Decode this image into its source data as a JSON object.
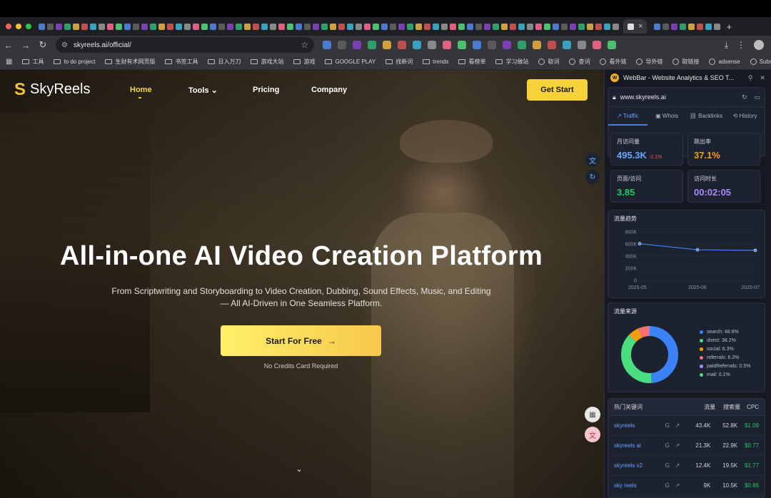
{
  "browser": {
    "tab_title": "",
    "close_tab": "×",
    "new_tab": "+",
    "url": "skyreels.ai/official/",
    "bookmarks": [
      "工具",
      "to do project",
      "生财有术网页版",
      "书签工具",
      "日入万刀",
      "游戏大站",
      "游戏",
      "GOOGLE PLAY",
      "找新词",
      "trends",
      "看榜单",
      "学习做站",
      "取词",
      "查词",
      "看外链",
      "导外链",
      "取链接",
      "adsense",
      "Submit"
    ]
  },
  "site": {
    "logo": "SkyReels",
    "nav": {
      "home": "Home",
      "tools": "Tools",
      "pricing": "Pricing",
      "company": "Company"
    },
    "get_started": "Get Start",
    "hero_title": "All-in-one AI Video Creation Platform",
    "hero_subtitle_1": "From Scriptwriting and Storyboarding to Video Creation, Dubbing, Sound Effects, Music, and Editing",
    "hero_subtitle_2": "— All AI-Driven in One Seamless Platform.",
    "cta": "Start For Free",
    "cta_arrow": "→",
    "no_credit": "No Credits Card Required"
  },
  "webbar": {
    "title": "WebBar - Website Analytics & SEO T...",
    "domain": "www.skyreels.ai",
    "tabs": [
      "Traffic",
      "Whois",
      "Backlinks",
      "History"
    ],
    "stats": [
      {
        "label": "月访问量",
        "value": "495.3K",
        "delta": "-2.1%",
        "color": "#6aa8ff"
      },
      {
        "label": "跳出率",
        "value": "37.1%",
        "color": "#f59e0b"
      },
      {
        "label": "页面/访问",
        "value": "3.85",
        "color": "#22c55e"
      },
      {
        "label": "访问时长",
        "value": "00:02:05",
        "color": "#a78bfa"
      }
    ],
    "trend_title": "流量趋势",
    "source_title": "流量来源",
    "sources": [
      {
        "label": "search: 48.8%",
        "color": "#3b82f6"
      },
      {
        "label": "direct: 38.2%",
        "color": "#4ade80"
      },
      {
        "label": "social: 6.3%",
        "color": "#f59e0b"
      },
      {
        "label": "referrals: 6.2%",
        "color": "#f87171"
      },
      {
        "label": "paidReferrals: 0.5%",
        "color": "#a78bfa"
      },
      {
        "label": "mail: 0.1%",
        "color": "#4ade80"
      }
    ],
    "keywords_title": "热门关键词",
    "kw_cols": [
      "流量",
      "搜索量",
      "CPC"
    ],
    "keywords": [
      {
        "name": "skyreels",
        "traffic": "43.4K",
        "volume": "52.8K",
        "cpc": "$1.09"
      },
      {
        "name": "skyreels ai",
        "traffic": "21.3K",
        "volume": "22.9K",
        "cpc": "$0.77"
      },
      {
        "name": "skyreels v2",
        "traffic": "12.4K",
        "volume": "19.5K",
        "cpc": "$1.77"
      },
      {
        "name": "sky reels",
        "traffic": "9K",
        "volume": "10.5K",
        "cpc": "$0.86"
      }
    ]
  },
  "chart_data": [
    {
      "type": "line",
      "title": "流量趋势",
      "x": [
        "2025-05",
        "2025-06",
        "2025-07"
      ],
      "values": [
        605000,
        505000,
        495300
      ],
      "ylim": [
        0,
        800000
      ],
      "yticks": [
        "0",
        "200K",
        "400K",
        "600K",
        "800K"
      ]
    },
    {
      "type": "pie",
      "title": "流量来源",
      "categories": [
        "search",
        "direct",
        "social",
        "referrals",
        "paidReferrals",
        "mail"
      ],
      "values": [
        48.8,
        38.2,
        6.3,
        6.2,
        0.5,
        0.1
      ]
    }
  ]
}
